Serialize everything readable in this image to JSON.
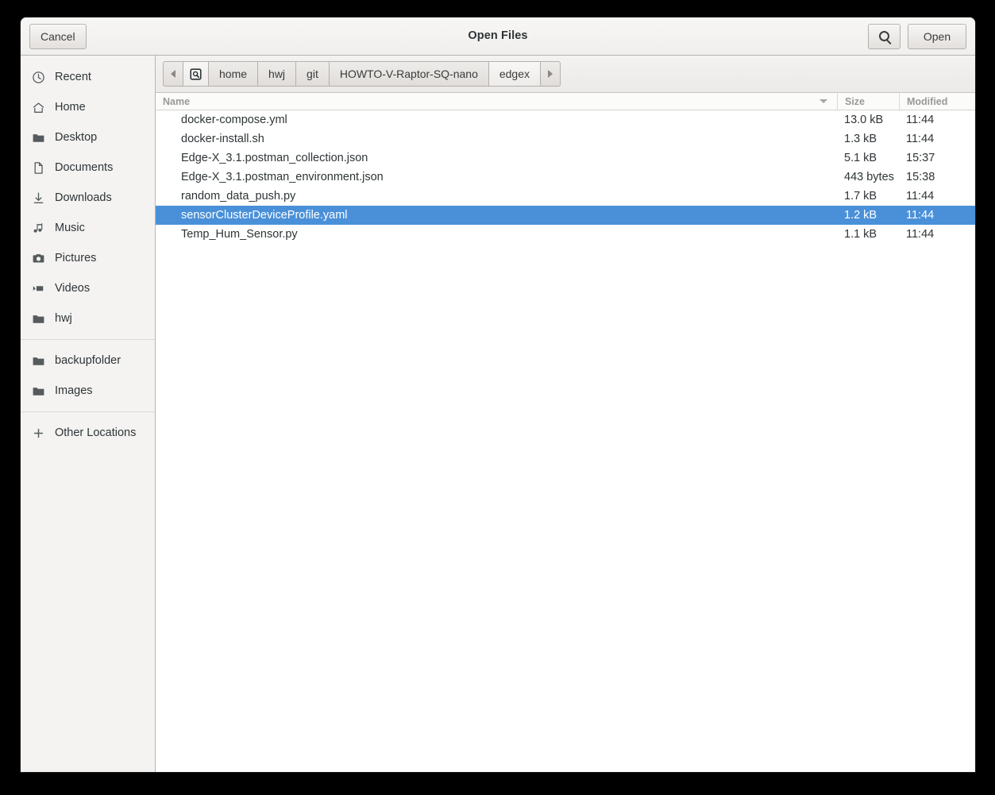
{
  "window": {
    "title": "Open Files"
  },
  "header": {
    "cancel_label": "Cancel",
    "open_label": "Open",
    "search_icon": "search-icon"
  },
  "sidebar": {
    "groups": [
      {
        "items": [
          {
            "label": "Recent",
            "icon": "clock-icon"
          },
          {
            "label": "Home",
            "icon": "home-icon"
          },
          {
            "label": "Desktop",
            "icon": "folder-icon"
          },
          {
            "label": "Documents",
            "icon": "document-icon"
          },
          {
            "label": "Downloads",
            "icon": "download-icon"
          },
          {
            "label": "Music",
            "icon": "music-note-icon"
          },
          {
            "label": "Pictures",
            "icon": "camera-icon"
          },
          {
            "label": "Videos",
            "icon": "video-icon"
          },
          {
            "label": "hwj",
            "icon": "folder-icon"
          }
        ]
      },
      {
        "items": [
          {
            "label": "backupfolder",
            "icon": "folder-icon"
          },
          {
            "label": "Images",
            "icon": "folder-icon"
          }
        ]
      },
      {
        "items": [
          {
            "label": "Other Locations",
            "icon": "plus-icon"
          }
        ]
      }
    ]
  },
  "pathbar": {
    "back_icon": "chevron-left-icon",
    "location_icon": "location-icon",
    "forward_icon": "chevron-right-icon",
    "crumbs": [
      {
        "label": "home",
        "current": false
      },
      {
        "label": "hwj",
        "current": false
      },
      {
        "label": "git",
        "current": false
      },
      {
        "label": "HOWTO-V-Raptor-SQ-nano",
        "current": false
      },
      {
        "label": "edgex",
        "current": true
      }
    ]
  },
  "filelist": {
    "columns": {
      "name": "Name",
      "size": "Size",
      "modified": "Modified"
    },
    "sort_indicator": "chevron-down-icon",
    "rows": [
      {
        "name": "docker-compose.yml",
        "size": "13.0 kB",
        "modified": "11:44",
        "selected": false
      },
      {
        "name": "docker-install.sh",
        "size": "1.3 kB",
        "modified": "11:44",
        "selected": false
      },
      {
        "name": "Edge-X_3.1.postman_collection.json",
        "size": "5.1 kB",
        "modified": "15:37",
        "selected": false
      },
      {
        "name": "Edge-X_3.1.postman_environment.json",
        "size": "443 bytes",
        "modified": "15:38",
        "selected": false
      },
      {
        "name": "random_data_push.py",
        "size": "1.7 kB",
        "modified": "11:44",
        "selected": false
      },
      {
        "name": "sensorClusterDeviceProfile.yaml",
        "size": "1.2 kB",
        "modified": "11:44",
        "selected": true
      },
      {
        "name": "Temp_Hum_Sensor.py",
        "size": "1.1 kB",
        "modified": "11:44",
        "selected": false
      }
    ]
  },
  "colors": {
    "selection": "#4a90d9",
    "window_bg": "#ffffff",
    "sidebar_bg": "#f4f3f2",
    "header_bg": "#f2f1f0"
  }
}
